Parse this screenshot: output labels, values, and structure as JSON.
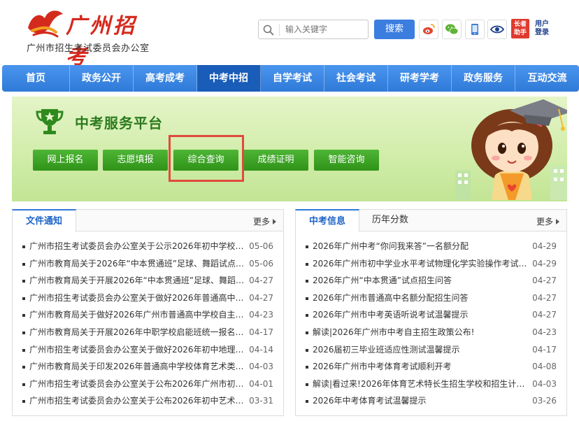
{
  "header": {
    "logo_text": "广州招考",
    "subtitle": "广州市招生考试委员会办公室",
    "search_placeholder": "输入关键字",
    "search_button": "搜索",
    "elder_label": "长者助手",
    "user_label": "用户登录",
    "icons": [
      "weibo-icon",
      "wechat-icon",
      "mobile-icon",
      "eye-icon"
    ]
  },
  "nav": {
    "items": [
      "首页",
      "政务公开",
      "高考成考",
      "中考中招",
      "自学考试",
      "社会考试",
      "研考学考",
      "政务服务",
      "互动交流"
    ],
    "active_index": 3
  },
  "banner": {
    "title": "中考服务平台",
    "buttons": [
      "网上报名",
      "志愿填报",
      "综合查询",
      "成绩证明",
      "智能咨询"
    ],
    "highlighted": "综合查询"
  },
  "left_panel": {
    "tab": "文件通知",
    "more": "更多",
    "items": [
      {
        "text": "广州市招生考试委员会办公室关于公示2026年初中学校符合...",
        "date": "05-06"
      },
      {
        "text": "广州市教育局关于2026年“中本贯通班”足球、舞蹈试点项...",
        "date": "05-06"
      },
      {
        "text": "广州市教育局关于开展2026年“中本贯通班”足球、舞蹈试...",
        "date": "04-27"
      },
      {
        "text": "广州市招生考试委员会办公室关于做好2026年普通高中名额...",
        "date": "04-27"
      },
      {
        "text": "广州市教育局关于做好2026年广州市普通高中学校自主招生...",
        "date": "04-23"
      },
      {
        "text": "广州市教育局关于开展2026年中职学校启能班统一报名甄选...",
        "date": "04-17"
      },
      {
        "text": "广州市招生考试委员会办公室关于做好2026年初中地理、生...",
        "date": "04-14"
      },
      {
        "text": "广州市教育局关于印发2026年普通高中学校体育艺术类特长...",
        "date": "04-03"
      },
      {
        "text": "广州市招生考试委员会办公室关于公布2026年广州市初中学...",
        "date": "04-01"
      },
      {
        "text": "广州市招生考试委员会办公室关于公布2026年初中艺术学业...",
        "date": "03-31"
      }
    ]
  },
  "right_panel": {
    "tabs": [
      "中考信息",
      "历年分数"
    ],
    "more": "更多",
    "items": [
      {
        "text": "2026年广州中考“你问我来答”一名额分配",
        "date": "04-29"
      },
      {
        "text": "2026年广州市初中学业水平考试物理化学实验操作考试温馨...",
        "date": "04-29"
      },
      {
        "text": "2026年广州“中本贯通”试点招生问答",
        "date": "04-27"
      },
      {
        "text": "2026年广州市普通高中名额分配招生问答",
        "date": "04-27"
      },
      {
        "text": "2026年广州市中考英语听说考试温馨提示",
        "date": "04-27"
      },
      {
        "text": "解读|2026年广州市中考自主招生政策公布!",
        "date": "04-23"
      },
      {
        "text": "2026届初三毕业班适应性测试温馨提示",
        "date": "04-17"
      },
      {
        "text": "2026年广州市中考体育考试顺利开考",
        "date": "04-08"
      },
      {
        "text": "解读|看过来!2026年体育艺术特长生招生学校和招生计划公...",
        "date": "04-03"
      },
      {
        "text": "2026年中考体育考试温馨提示",
        "date": "03-26"
      }
    ]
  },
  "colors": {
    "nav_blue": "#2f7ad8",
    "brand_red": "#d42a1e",
    "banner_green": "#2c7a1e",
    "button_green": "#3aa322",
    "highlight_red": "#e04a3c"
  }
}
